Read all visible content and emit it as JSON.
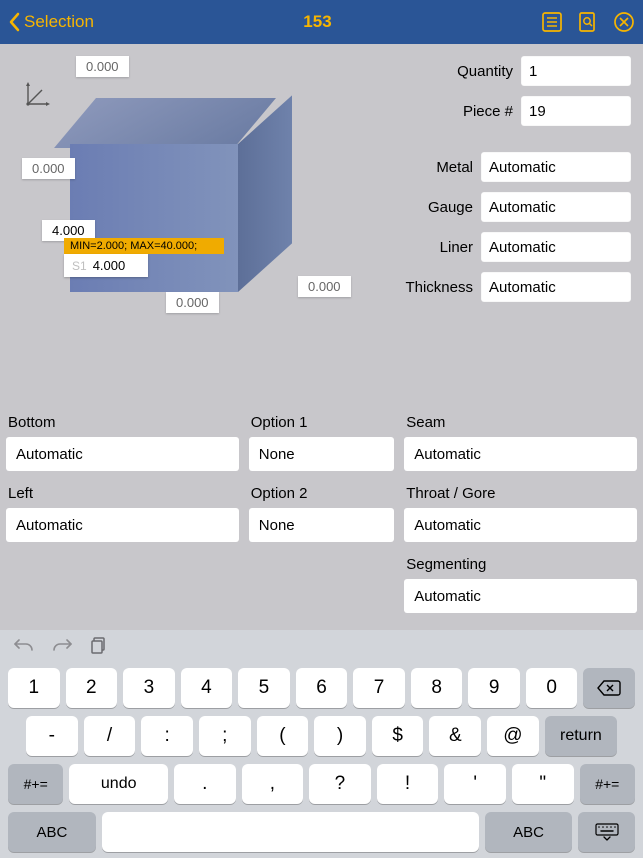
{
  "nav": {
    "back_label": "Selection",
    "title": "153"
  },
  "preview": {
    "dim_top": "0.000",
    "dim_left": "0.000",
    "dim_left2": "4.000",
    "dim_bottom": "0.000",
    "dim_right_low": "0.000",
    "tooltip": "MIN=2.000; MAX=40.000;",
    "active_s": "S1",
    "active_val": "4.000"
  },
  "right_form": [
    {
      "label": "Quantity",
      "value": "1",
      "narrow": true
    },
    {
      "label": "Piece #",
      "value": "19",
      "narrow": true
    },
    {
      "label": "Metal",
      "value": "Automatic",
      "narrow": false
    },
    {
      "label": "Gauge",
      "value": "Automatic",
      "narrow": false
    },
    {
      "label": "Liner",
      "value": "Automatic",
      "narrow": false
    },
    {
      "label": "Thickness",
      "value": "Automatic",
      "narrow": false
    }
  ],
  "options": {
    "col1": [
      {
        "label": "Bottom",
        "value": "Automatic"
      },
      {
        "label": "Left",
        "value": "Automatic"
      }
    ],
    "col2": [
      {
        "label": "Option 1",
        "value": "None"
      },
      {
        "label": "Option 2",
        "value": "None"
      }
    ],
    "col3": [
      {
        "label": "Seam",
        "value": "Automatic"
      },
      {
        "label": "Throat / Gore",
        "value": "Automatic"
      },
      {
        "label": "Segmenting",
        "value": "Automatic"
      }
    ]
  },
  "keyboard": {
    "row1": [
      "1",
      "2",
      "3",
      "4",
      "5",
      "6",
      "7",
      "8",
      "9",
      "0"
    ],
    "row2": [
      "-",
      "/",
      ":",
      ";",
      "(",
      ")",
      "$",
      "&",
      "@"
    ],
    "row3_shift": "#+=",
    "row3_undo": "undo",
    "row3": [
      ".",
      ",",
      "?",
      "!",
      "'",
      "\""
    ],
    "row4_abc": "ABC",
    "return": "return"
  }
}
